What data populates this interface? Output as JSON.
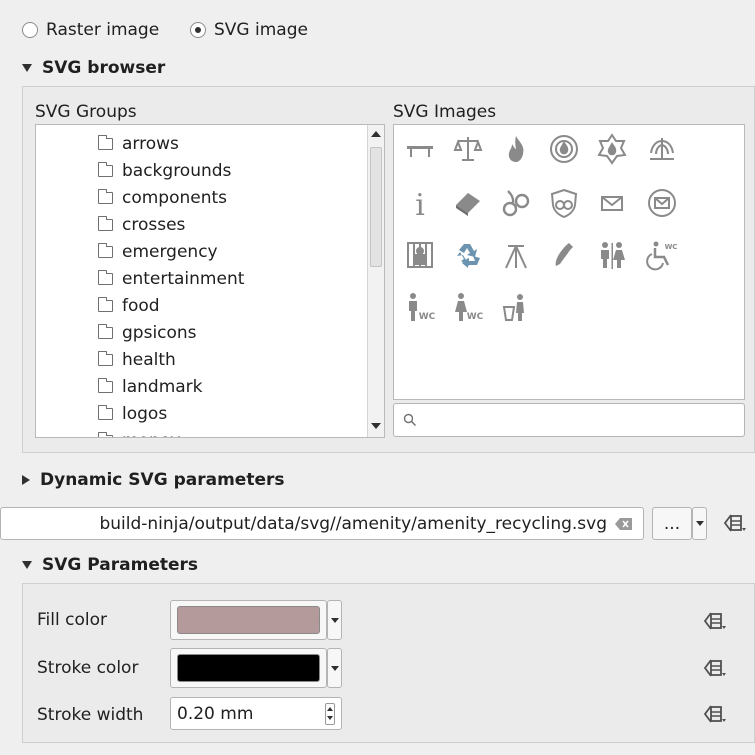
{
  "image_type": {
    "raster_label": "Raster image",
    "svg_label": "SVG image",
    "selected": "SVG image"
  },
  "svg_browser": {
    "title": "SVG browser",
    "groups_label": "SVG Groups",
    "images_label": "SVG Images",
    "groups": [
      "arrows",
      "backgrounds",
      "components",
      "crosses",
      "emergency",
      "entertainment",
      "food",
      "gpsicons",
      "health",
      "landmark",
      "logos",
      "money"
    ],
    "images": [
      "bench-icon",
      "scales-icon",
      "fire-icon",
      "fire-badge-icon",
      "fire-badge-crossed-icon",
      "fountain-icon",
      "info-icon",
      "eraser-icon",
      "handcuffs-icon",
      "police-badge-icon",
      "mail-icon",
      "mail-circle-icon",
      "prison-icon",
      "recycling-icon",
      "survey-point-icon",
      "telephone-icon",
      "toilets-icon",
      "wheelchair-wc-icon",
      "wc-men-icon",
      "wc-women-icon",
      "waste-basket-icon"
    ],
    "search_placeholder": ""
  },
  "dynamic_params": {
    "title": "Dynamic SVG parameters"
  },
  "path": {
    "value": "build-ninja/output/data/svg//amenity/amenity_recycling.svg",
    "browse_label": "..."
  },
  "svg_parameters": {
    "title": "SVG Parameters",
    "fill_label": "Fill color",
    "fill_color": "#b59a9c",
    "stroke_label": "Stroke color",
    "stroke_color": "#000000",
    "width_label": "Stroke width",
    "width_value": "0.20 mm"
  }
}
